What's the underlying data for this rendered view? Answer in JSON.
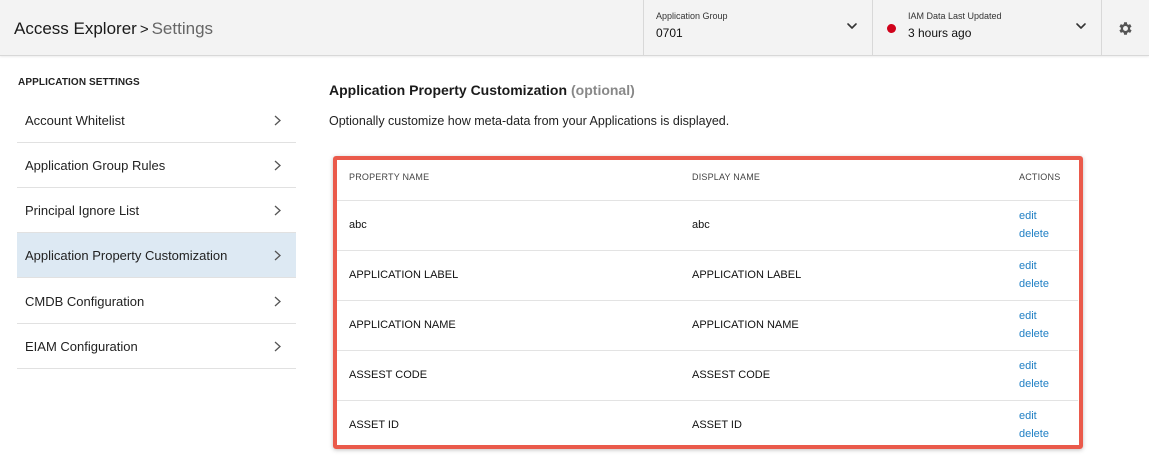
{
  "header": {
    "breadcrumb": {
      "root": "Access Explorer",
      "separator": ">",
      "current": "Settings"
    },
    "application_group": {
      "label": "Application Group",
      "value": "0701"
    },
    "iam_data": {
      "label": "IAM Data Last Updated",
      "value": "3 hours ago",
      "status_color": "#d0021b"
    },
    "icons": {
      "dropdown": "chevron-down-icon",
      "settings": "gear-icon"
    }
  },
  "sidebar": {
    "heading": "APPLICATION SETTINGS",
    "items": [
      {
        "label": "Account Whitelist",
        "active": false
      },
      {
        "label": "Application Group Rules",
        "active": false
      },
      {
        "label": "Principal Ignore List",
        "active": false
      },
      {
        "label": "Application Property Customization",
        "active": true
      },
      {
        "label": "CMDB Configuration",
        "active": false
      },
      {
        "label": "EIAM Configuration",
        "active": false
      }
    ]
  },
  "main": {
    "title": "Application Property Customization",
    "title_suffix": "(optional)",
    "description": "Optionally customize how meta-data from your Applications is displayed.",
    "table": {
      "columns": {
        "property": "PROPERTY NAME",
        "display": "DISPLAY NAME",
        "actions": "ACTIONS"
      },
      "rows": [
        {
          "property": "abc",
          "display": "abc",
          "edit": "edit",
          "delete": "delete"
        },
        {
          "property": "APPLICATION LABEL",
          "display": "APPLICATION LABEL",
          "edit": "edit",
          "delete": "delete"
        },
        {
          "property": "APPLICATION NAME",
          "display": "APPLICATION NAME",
          "edit": "edit",
          "delete": "delete"
        },
        {
          "property": "ASSEST CODE",
          "display": "ASSEST CODE",
          "edit": "edit",
          "delete": "delete"
        },
        {
          "property": "ASSET ID",
          "display": "ASSET ID",
          "edit": "edit",
          "delete": "delete"
        }
      ]
    }
  },
  "colors": {
    "link": "#1f7fc4",
    "highlight_border": "#ea5a4b",
    "active_item_bg": "#dde9f3",
    "header_bg": "#f3f3f3"
  }
}
